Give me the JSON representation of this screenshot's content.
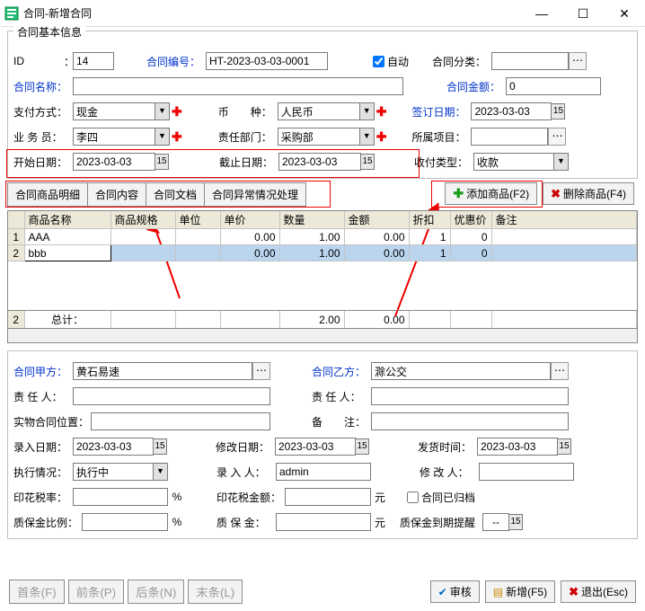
{
  "window": {
    "title": "合同-新增合同"
  },
  "group1_title": "合同基本信息",
  "labels": {
    "id": "ID",
    "contract_no": "合同编号：",
    "auto": "自动",
    "category": "合同分类：",
    "name": "合同名称：",
    "amount": "合同金额：",
    "paytype": "支付方式：",
    "currency": "币  种：",
    "signdate": "签订日期：",
    "salesman": "业 务 员：",
    "dept": "责任部门：",
    "project": "所属项目：",
    "startdate": "开始日期：",
    "enddate": "截止日期：",
    "recvtype": "收付类型：",
    "partyA": "合同甲方：",
    "partyB": "合同乙方：",
    "dutyA": "责 任 人：",
    "dutyB": "责 任 人：",
    "physloc": "实物合同位置：",
    "remark": "备  注：",
    "inputdate": "录入日期：",
    "modifydate": "修改日期：",
    "shipdate": "发货时间：",
    "execstate": "执行情况：",
    "inputby": "录 入 人：",
    "modifyby": "修 改 人：",
    "stamprate": "印花税率：",
    "percent": "%",
    "stampamt": "印花税金额：",
    "yuan": "元",
    "archived": "合同已归档",
    "depositrate": "质保金比例：",
    "deposit": "质 保 金：",
    "deposit_due": "质保金到期提醒",
    "id_colon": "："
  },
  "values": {
    "id": "14",
    "contract_no": "HT-2023-03-03-0001",
    "auto_checked": true,
    "name": "",
    "amount": "0",
    "paytype": "现金",
    "currency": "人民币",
    "signdate": "2023-03-03",
    "salesman": "李四",
    "dept": "采购部",
    "startdate": "2023-03-03",
    "enddate": "2023-03-03",
    "recvtype": "收款",
    "partyA": "黄石易速",
    "partyB": "滁公交",
    "inputdate": "2023-03-03",
    "modifydate": "2023-03-03",
    "shipdate": "2023-03-03",
    "execstate": "执行中",
    "inputby": "admin",
    "deposit_due_val": "--"
  },
  "tabs": [
    "合同商品明细",
    "合同内容",
    "合同文档",
    "合同异常情况处理"
  ],
  "btns": {
    "addprod": "添加商品(F2)",
    "delprod": "删除商品(F4)",
    "first": "首条(F)",
    "prev": "前条(P)",
    "next": "后条(N)",
    "last": "末条(L)",
    "audit": "审核",
    "new": "新增(F5)",
    "exit": "退出(Esc)"
  },
  "grid": {
    "cols": [
      "商品名称",
      "商品规格",
      "单位",
      "单价",
      "数量",
      "金额",
      "折扣",
      "优惠价",
      "备注"
    ],
    "rows": [
      {
        "n": "1",
        "name": "AAA",
        "spec": "",
        "unit": "",
        "price": "0.00",
        "qty": "1.00",
        "amt": "0.00",
        "disc": "1",
        "pref": "0",
        "rem": ""
      },
      {
        "n": "2",
        "name": "bbb",
        "spec": "",
        "unit": "",
        "price": "0.00",
        "qty": "1.00",
        "amt": "0.00",
        "disc": "1",
        "pref": "0",
        "rem": ""
      }
    ],
    "total_label": "总计：",
    "total_qty": "2.00",
    "total_amt": "0.00",
    "total_n": "2"
  }
}
